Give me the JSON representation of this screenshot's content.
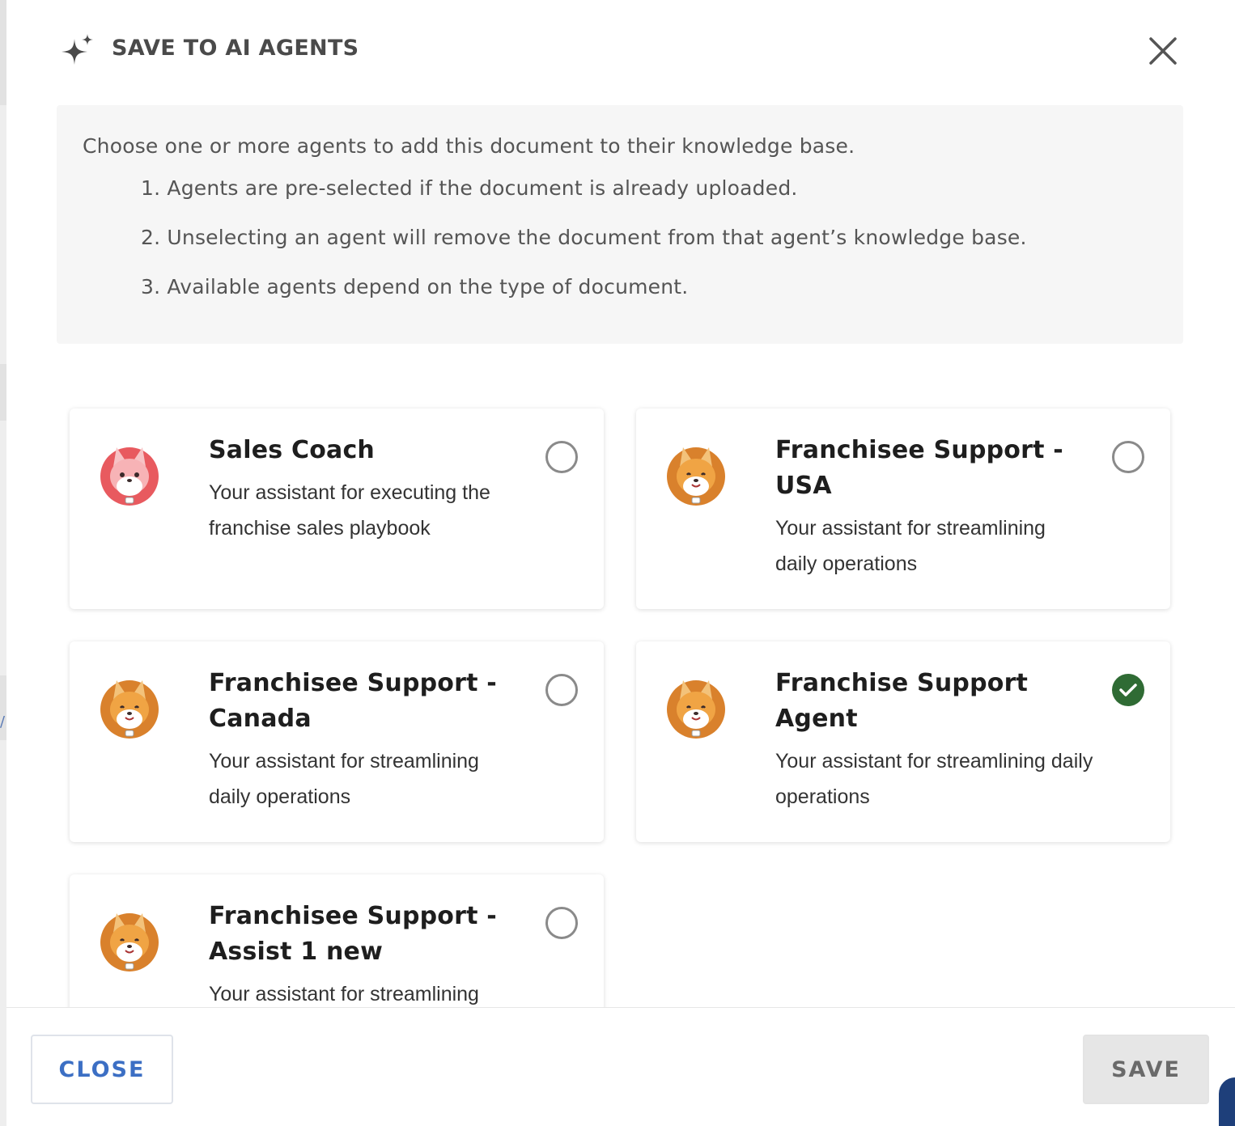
{
  "dialog": {
    "title": "SAVE TO AI AGENTS",
    "icons": {
      "title": "sparkle-icon",
      "close": "close-x-icon"
    }
  },
  "info": {
    "intro": "Choose one or more agents to add this document to their knowledge base.",
    "items": [
      "1. Agents are pre-selected if the document is already uploaded.",
      "2. Unselecting an agent will remove the document from that agent’s knowledge base.",
      "3. Available agents depend on the type of document."
    ]
  },
  "agents": [
    {
      "name": "Sales Coach",
      "description": "Your assistant for executing the franchise sales playbook",
      "selected": false,
      "avatar": "pink-fox-avatar"
    },
    {
      "name": "Franchisee Support - USA",
      "description": "Your assistant for streamlining daily operations",
      "selected": false,
      "avatar": "orange-fox-avatar"
    },
    {
      "name": "Franchisee Support - Canada",
      "description": "Your assistant for streamlining daily operations",
      "selected": false,
      "avatar": "orange-fox-avatar"
    },
    {
      "name": "Franchise Support Agent",
      "description": "Your assistant for streamlining daily operations",
      "selected": true,
      "avatar": "orange-fox-avatar"
    },
    {
      "name": "Franchisee Support - Assist 1 new",
      "description": "Your assistant for streamlining daily",
      "selected": false,
      "avatar": "orange-fox-avatar"
    }
  ],
  "footer": {
    "close_label": "CLOSE",
    "save_label": "SAVE"
  },
  "colors": {
    "accent_blue": "#3c6fc4",
    "selected_green": "#2f6b34",
    "info_bg": "#f6f6f6",
    "save_disabled_bg": "#e6e6e6"
  }
}
